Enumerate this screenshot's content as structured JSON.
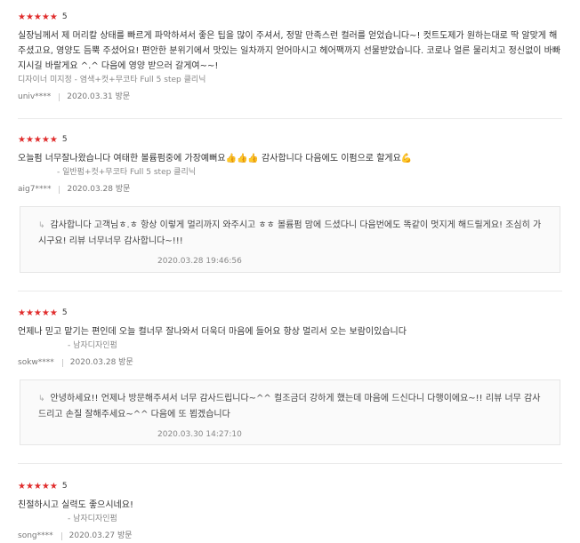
{
  "reviews": [
    {
      "stars": "★★★★★",
      "score": "5",
      "text": "실장님께서 제 머리칼 상태를 빠르게 파악하셔서 좋은 팁을 많이 주셔서, 정말 만족스런 컬러를 얻었습니다~! 컷트도제가 원하는대로 딱 알맞게 해주셨고요, 영양도 듬뿍 주셨어요! 편안한 분위기에서 맛있는 일차까지 얻어마시고 헤어팩까지 선물받았습니다. 코로나 얼른 물리치고 정신없이 바빠지시길 바랄게요 ^.^ 다음에 영양 받으러 갈게여~~!",
      "service": "디자이너 미지정 - 염색+컷+무코타 Full 5 step 클리닉",
      "author": "univ****",
      "date": "2020.03.31 방문"
    },
    {
      "stars": "★★★★★",
      "score": "5",
      "text": "오늘펌 너무잘나왔습니다 여태한 볼륨펌중에 가장예뻐요",
      "text_emoji": "👍👍👍",
      "text_after": " 감사합니다 다음에도 이펌으로 할게요",
      "text_emoji2": "💪",
      "service": "- 일반펌+컷+무코타 Full 5 step 클리닉",
      "author": "aig7****",
      "date": "2020.03.28 방문",
      "reply": {
        "text": "감사합니다 고객님ㅎ.ㅎ 항상 이렇게 멀리까지 와주시고 ㅎㅎ 볼륨펌 맘에 드셨다니 다음번에도 똑같이 멋지게 해드릴게요! 조심히 가시구요! 리뷰 너무너무 감사합니다~!!!",
        "date": "2020.03.28 19:46:56"
      }
    },
    {
      "stars": "★★★★★",
      "score": "5",
      "text": "언제나 믿고 맡기는 편인데 오늘 컬너무 잘나와서 더욱더 마음에 들어요 항상 멀리서 오는 보람이있습니다",
      "service": "- 남자디자인펌",
      "author": "sokw****",
      "date": "2020.03.28 방문",
      "reply": {
        "text": "안녕하세요!! 언제나 방문해주셔서 너무 감사드립니다~^^ 컬조금더 강하게 했는데 마음에 드신다니 다행이에요~!! 리뷰 너무 감사드리고 손질 잘해주세요~^^ 다음에 또 뵙겠습니다",
        "date": "2020.03.30 14:27:10"
      }
    },
    {
      "stars": "★★★★★",
      "score": "5",
      "text": "친절하시고 실력도 좋으시네요!",
      "service": "- 남자디자인펌",
      "author": "song****",
      "date": "2020.03.27 방문"
    }
  ],
  "icons": {
    "reply": "reply-arrow-icon",
    "star": "star-icon"
  },
  "colors": {
    "star": "#e02c2c"
  }
}
